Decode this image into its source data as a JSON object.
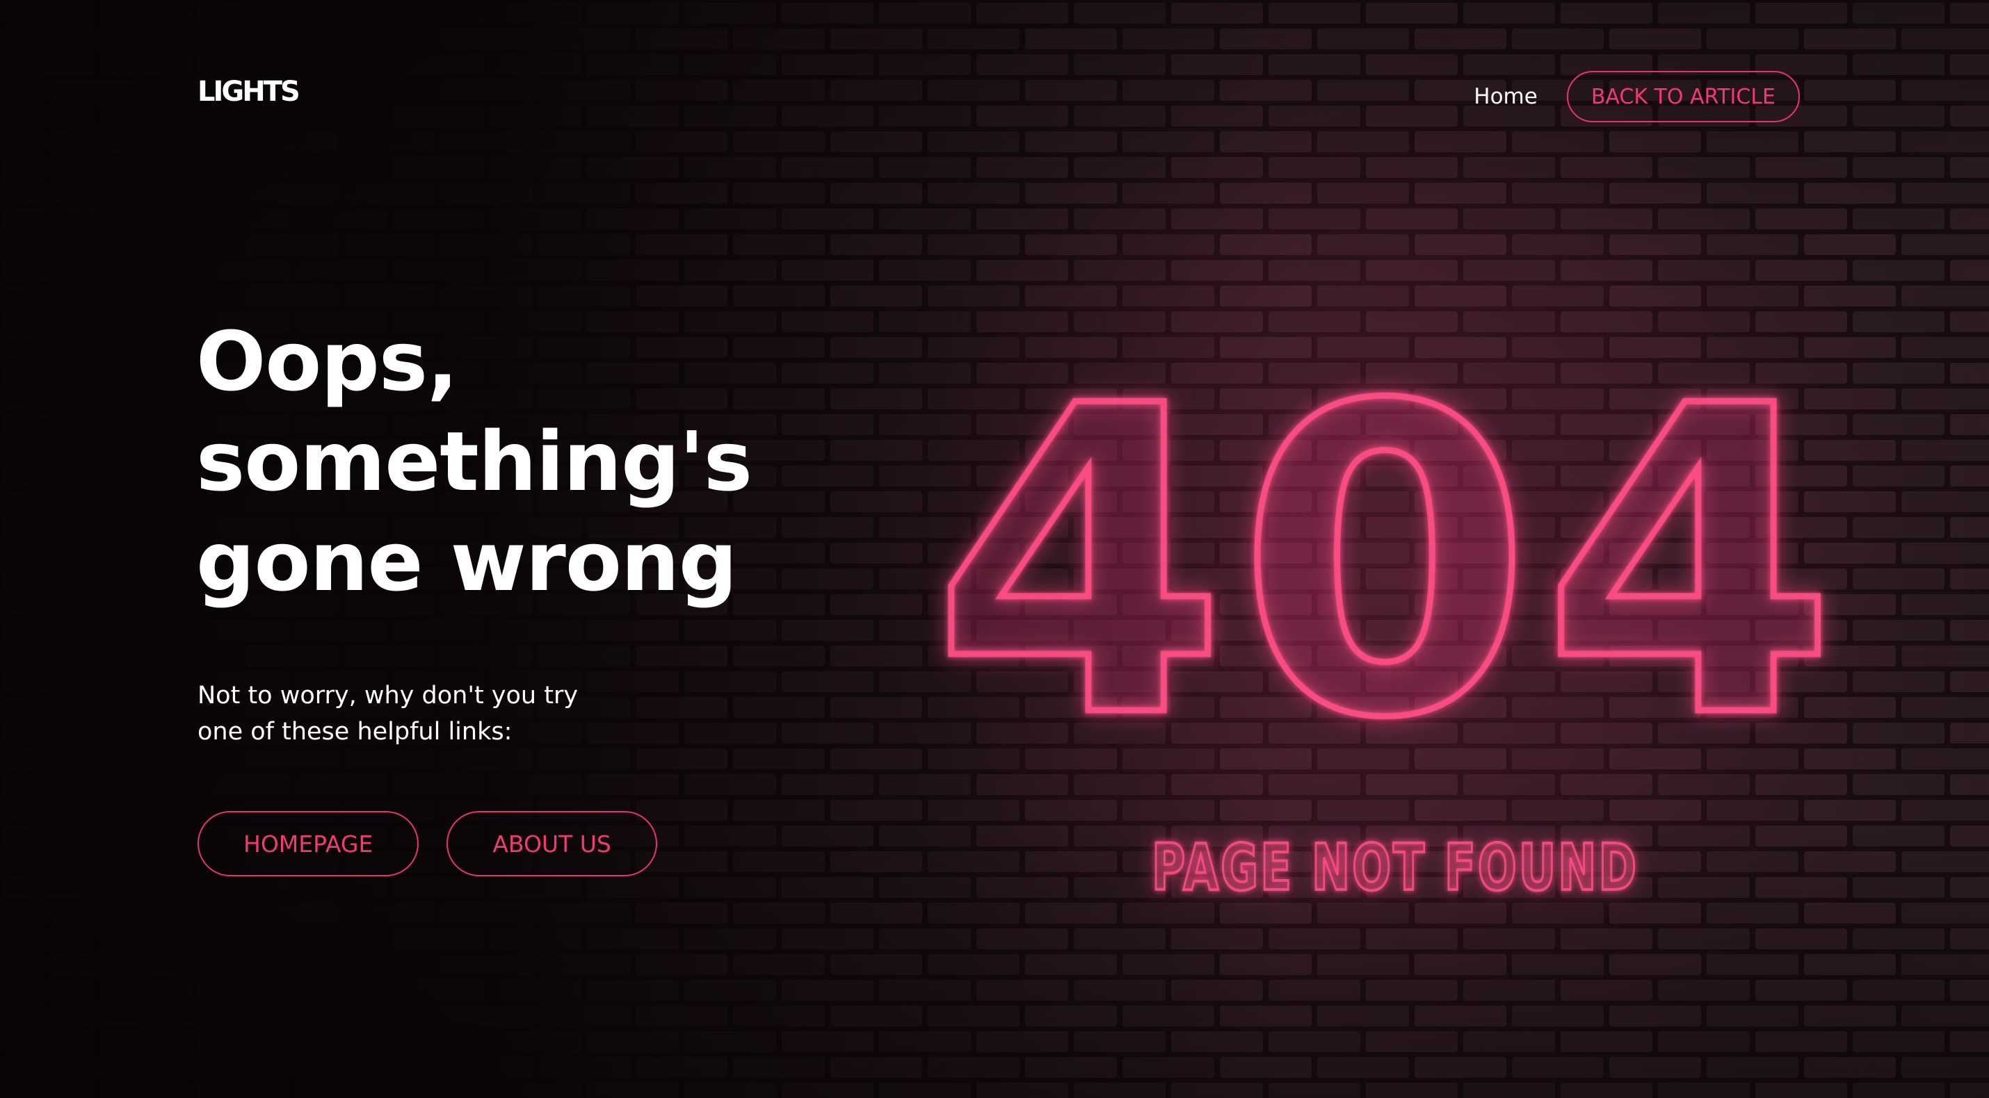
{
  "header": {
    "logo_text": "LIGHTS",
    "nav_home_label": "Home",
    "nav_back_label": "BACK TO ARTICLE"
  },
  "hero": {
    "headline_lines": [
      "Oops,",
      "something's",
      "gone wrong"
    ],
    "subtext_lines": [
      "Not to worry, why don't you try",
      "one of these helpful links:"
    ],
    "buttons": {
      "homepage_label": "HOMEPAGE",
      "about_label": "ABOUT US"
    }
  },
  "sign": {
    "code_text": "404",
    "caption_text": "PAGE NOT FOUND"
  },
  "colors": {
    "accent": "#ef3a72",
    "neon": "#ff4f86",
    "background": "#0b0608",
    "brick": "#3a252b",
    "mortar": "#1a0f13"
  },
  "icons": {
    "logo": "lights-wordmark"
  }
}
